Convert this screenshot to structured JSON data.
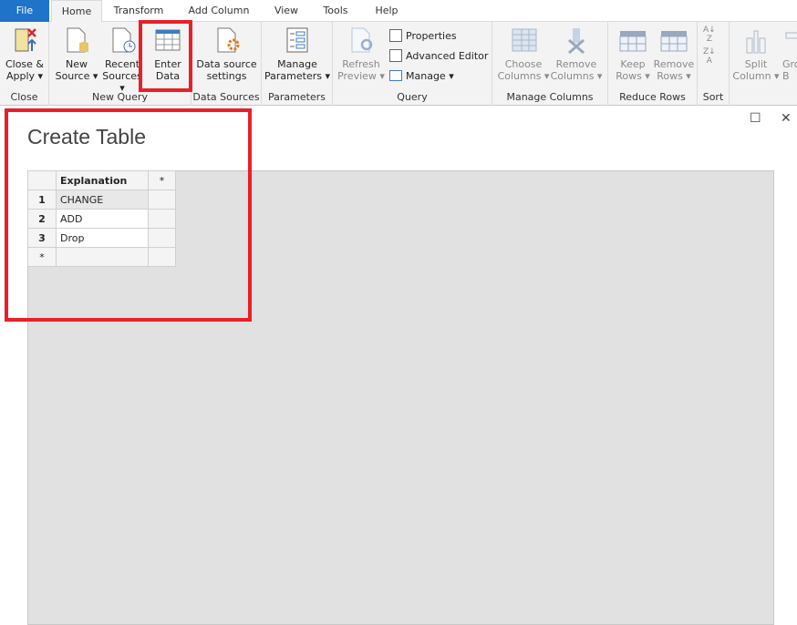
{
  "tabs": [
    "File",
    "Home",
    "Transform",
    "Add Column",
    "View",
    "Tools",
    "Help"
  ],
  "active_tab": "Home",
  "ribbon": {
    "groups": [
      "Close",
      "New Query",
      "Data Sources",
      "Parameters",
      "Query",
      "Manage Columns",
      "Reduce Rows",
      "Sort"
    ],
    "close_apply": [
      "Close &",
      "Apply ▾"
    ],
    "new_source": [
      "New",
      "Source ▾"
    ],
    "recent_sources": [
      "Recent",
      "Sources ▾"
    ],
    "enter_data": [
      "Enter",
      "Data"
    ],
    "data_source_settings": [
      "Data source",
      "settings"
    ],
    "manage_parameters": [
      "Manage",
      "Parameters ▾"
    ],
    "refresh_preview": [
      "Refresh",
      "Preview ▾"
    ],
    "properties": "Properties",
    "advanced_editor": "Advanced Editor",
    "manage": "Manage ▾",
    "choose_columns": [
      "Choose",
      "Columns ▾"
    ],
    "remove_columns": [
      "Remove",
      "Columns ▾"
    ],
    "keep_rows": [
      "Keep",
      "Rows ▾"
    ],
    "remove_rows": [
      "Remove",
      "Rows ▾"
    ],
    "split_column": [
      "Split",
      "Column ▾"
    ],
    "group_by": [
      "Gro",
      "B"
    ]
  },
  "dialog": {
    "title": "Create Table",
    "maximize": "☐",
    "close": "✕",
    "table": {
      "headers": [
        "",
        "Explanation",
        "*"
      ],
      "rows": [
        [
          "1",
          "CHANGE"
        ],
        [
          "2",
          "ADD"
        ],
        [
          "3",
          "Drop"
        ],
        [
          "*",
          ""
        ]
      ]
    }
  },
  "colors": {
    "highlight": "#e8202a",
    "file_tab": "#1f73c8"
  }
}
